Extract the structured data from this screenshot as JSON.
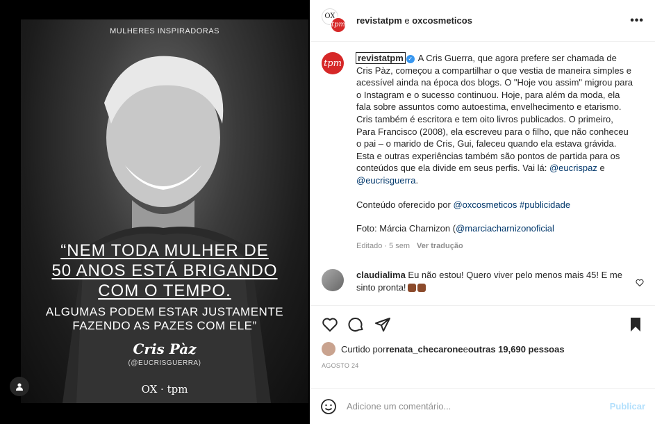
{
  "image": {
    "kicker": "MULHERES INSPIRADORAS",
    "quote_lines_big": [
      "“NEM TODA MULHER DE",
      "50 ANOS ESTÁ BRIGANDO",
      "COM O TEMPO."
    ],
    "quote_lines_small": [
      "ALGUMAS PODEM ESTAR JUSTAMENTE",
      "FAZENDO AS PAZES COM ELE”"
    ],
    "signature": "Cris Pàz",
    "handle": "(@EUCRISGUERRA)",
    "brands": "OX · tpm",
    "user_tag_icon": "person-icon"
  },
  "header": {
    "account1": "revistatpm",
    "joiner": " e ",
    "account2": "oxcosmeticos",
    "avatar1_text": "OX",
    "avatar2_text": "tpm",
    "more": "•••"
  },
  "caption": {
    "avatar_text": "tpm",
    "username": "revistatpm",
    "text1": " A Cris Guerra, que agora prefere ser chamada de Cris Pàz, começou a compartilhar o que vestia de maneira simples e acessível ainda na época dos blogs. O \"Hoje vou assim\" migrou para o Instagram e o sucesso continuou. Hoje, para além da moda, ela fala sobre assuntos como autoestima, envelhecimento e etarismo. Cris também é escritora e tem oito livros publicados. O primeiro, Para Francisco (2008), ela escreveu para o filho, que não conheceu o pai – o marido de Cris, Gui, faleceu quando ela estava grávida. Esta e outras experiências também são pontos de partida para os conteúdos que ela divide em seus perfis. Vai lá: ",
    "mention1": "@eucrispaz",
    "and": " e ",
    "mention2": "@eucrisguerra",
    "end": ".",
    "sponsor_prefix": "Conteúdo oferecido por ",
    "sponsor_mention": "@oxcosmeticos",
    "sponsor_tag": " #publicidade",
    "photo_prefix": "Foto: Márcia Charnizon (",
    "photo_mention": "@marciacharnizonoficial",
    "meta_edited": "Editado · 5 sem",
    "meta_translate": "Ver tradução"
  },
  "comment": {
    "username": "claudialima",
    "text": " Eu não estou! Quero viver pelo menos mais 45! E me sinto pronta!"
  },
  "actions": {
    "likes_prefix": "Curtido por ",
    "likes_user": "renata_checarone",
    "likes_mid": " e ",
    "likes_count": "outras 19,690 pessoas",
    "date": "AGOSTO 24"
  },
  "comment_box": {
    "placeholder": "Adicione um comentário...",
    "post_label": "Publicar"
  }
}
